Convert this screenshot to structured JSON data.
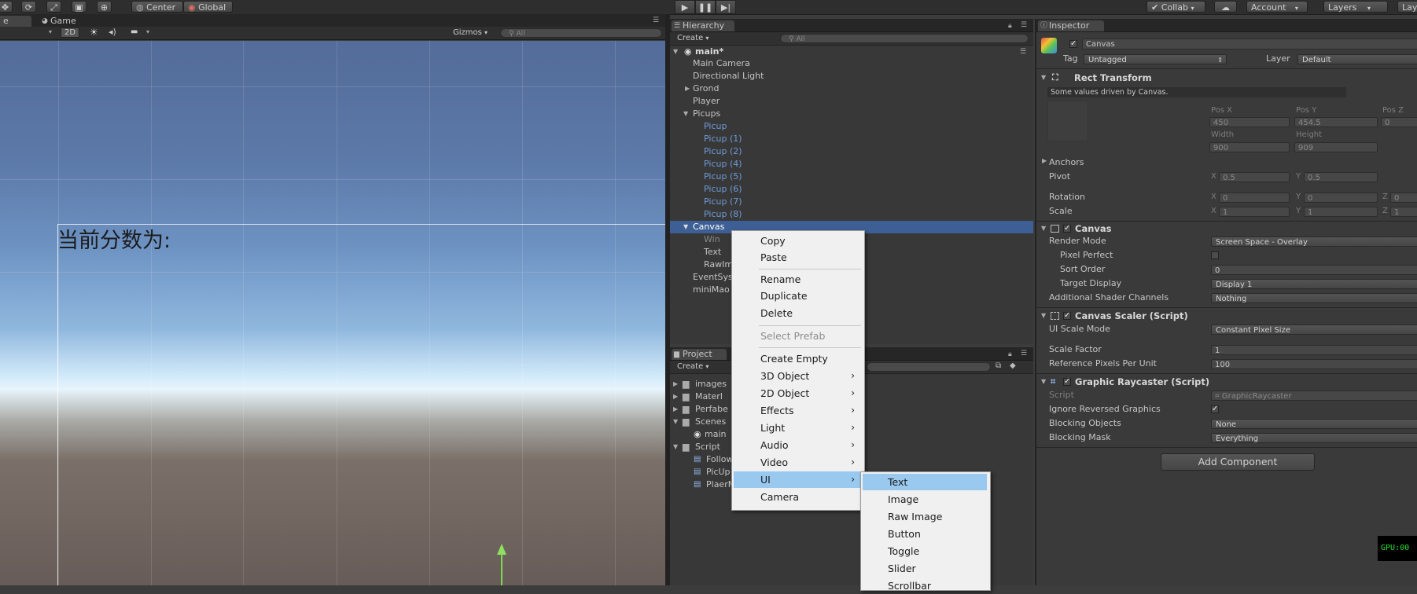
{
  "toolbar": {
    "pivot_label": "Center",
    "space_label": "Global",
    "collab_label": "Collab",
    "account_label": "Account",
    "layers_label": "Layers",
    "layout_label": "Lay"
  },
  "scene": {
    "tab_scene_partial": "e",
    "tab_game_label": "Game",
    "mode_2d": "2D",
    "gizmos_label": "Gizmos",
    "search_placeholder": "All",
    "canvas_text": "当前分数为:"
  },
  "hierarchy": {
    "tab_label": "Hierarchy",
    "create_label": "Create",
    "search_placeholder": "All",
    "scene_name": "main*",
    "items": [
      {
        "label": "Main Camera"
      },
      {
        "label": "Directional Light"
      },
      {
        "label": "Grond"
      },
      {
        "label": "Player"
      },
      {
        "label": "Picups"
      },
      {
        "label": "Picup"
      },
      {
        "label": "Picup (1)"
      },
      {
        "label": "Picup (2)"
      },
      {
        "label": "Picup (4)"
      },
      {
        "label": "Picup (5)"
      },
      {
        "label": "Picup (6)"
      },
      {
        "label": "Picup (7)"
      },
      {
        "label": "Picup (8)"
      },
      {
        "label": "Canvas"
      },
      {
        "label": "Win"
      },
      {
        "label": "Text"
      },
      {
        "label": "RawIm"
      },
      {
        "label": "EventSys"
      },
      {
        "label": "miniMao"
      }
    ]
  },
  "project": {
    "tab_label": "Project",
    "create_label": "Create",
    "items": [
      {
        "label": "images"
      },
      {
        "label": "Materl"
      },
      {
        "label": "Perfabe"
      },
      {
        "label": "Scenes"
      },
      {
        "label": "main"
      },
      {
        "label": "Script"
      },
      {
        "label": "Follow"
      },
      {
        "label": "PicUp"
      },
      {
        "label": "PlaerM"
      }
    ]
  },
  "context_menu": {
    "items": [
      {
        "label": "Copy"
      },
      {
        "label": "Paste"
      },
      {
        "label": "Rename"
      },
      {
        "label": "Duplicate"
      },
      {
        "label": "Delete"
      },
      {
        "label": "Select Prefab"
      },
      {
        "label": "Create Empty"
      },
      {
        "label": "3D Object"
      },
      {
        "label": "2D Object"
      },
      {
        "label": "Effects"
      },
      {
        "label": "Light"
      },
      {
        "label": "Audio"
      },
      {
        "label": "Video"
      },
      {
        "label": "UI"
      },
      {
        "label": "Camera"
      }
    ],
    "submenu_arrow": "›",
    "ui_submenu": [
      {
        "label": "Text"
      },
      {
        "label": "Image"
      },
      {
        "label": "Raw Image"
      },
      {
        "label": "Button"
      },
      {
        "label": "Toggle"
      },
      {
        "label": "Slider"
      },
      {
        "label": "Scrollbar"
      }
    ]
  },
  "inspector": {
    "tab_label": "Inspector",
    "object_name": "Canvas",
    "tag_label": "Tag",
    "tag_value": "Untagged",
    "layer_label": "Layer",
    "layer_value": "Default",
    "rect_transform": {
      "title": "Rect Transform",
      "note": "Some values driven by Canvas.",
      "posx_label": "Pos X",
      "posx": "450",
      "posy_label": "Pos Y",
      "posy": "454.5",
      "posz_label": "Pos Z",
      "posz": "0",
      "width_label": "Width",
      "width": "900",
      "height_label": "Height",
      "height": "909",
      "anchors_label": "Anchors",
      "pivot_label": "Pivot",
      "pivot_x": "0.5",
      "pivot_y": "0.5",
      "rotation_label": "Rotation",
      "rot_x": "0",
      "rot_y": "0",
      "rot_z": "0",
      "scale_label": "Scale",
      "scale_x": "1",
      "scale_y": "1",
      "scale_z": "1",
      "axis_x": "X",
      "axis_y": "Y",
      "axis_z": "Z"
    },
    "canvas": {
      "title": "Canvas",
      "render_mode_label": "Render Mode",
      "render_mode": "Screen Space - Overlay",
      "pixel_perfect_label": "Pixel Perfect",
      "sort_order_label": "Sort Order",
      "sort_order": "0",
      "target_display_label": "Target Display",
      "target_display": "Display 1",
      "shader_channels_label": "Additional Shader Channels",
      "shader_channels": "Nothing"
    },
    "canvas_scaler": {
      "title": "Canvas Scaler (Script)",
      "ui_scale_mode_label": "UI Scale Mode",
      "ui_scale_mode": "Constant Pixel Size",
      "scale_factor_label": "Scale Factor",
      "scale_factor": "1",
      "ref_ppu_label": "Reference Pixels Per Unit",
      "ref_ppu": "100"
    },
    "graphic_raycaster": {
      "title": "Graphic Raycaster (Script)",
      "script_label": "Script",
      "script_value": "GraphicRaycaster",
      "ignore_reversed_label": "Ignore Reversed Graphics",
      "blocking_objects_label": "Blocking Objects",
      "blocking_objects": "None",
      "blocking_mask_label": "Blocking Mask",
      "blocking_mask": "Everything"
    },
    "add_component": "Add Component",
    "gpu_overlay": "GPU:00"
  },
  "colors": {
    "selection": "#3e5f96",
    "menu_highlight": "#99c9ef",
    "prefab_blue": "#6f9bd8"
  }
}
